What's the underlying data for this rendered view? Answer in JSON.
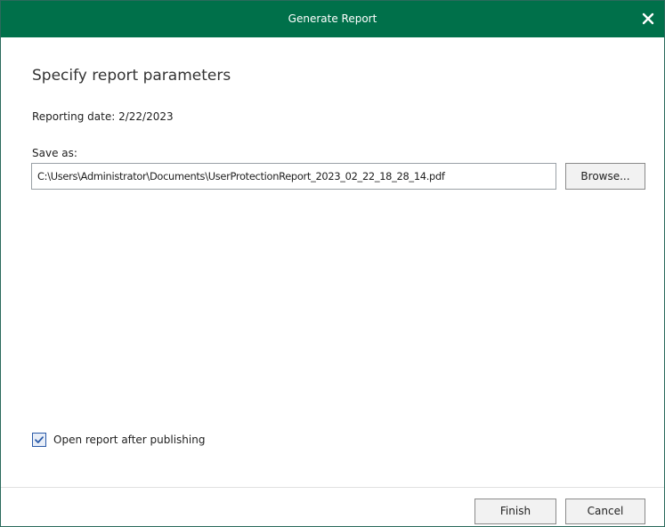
{
  "window": {
    "title": "Generate Report",
    "close_icon": "close-icon"
  },
  "main": {
    "heading": "Specify report parameters",
    "reporting_date_label": "Reporting date:",
    "reporting_date_value": "2/22/2023",
    "save_as_label": "Save as:",
    "save_as_value": "C:\\Users\\Administrator\\Documents\\UserProtectionReport_2023_02_22_18_28_14.pdf",
    "browse_label": "Browse...",
    "open_after_label": "Open report after publishing",
    "open_after_checked": true
  },
  "footer": {
    "finish_label": "Finish",
    "cancel_label": "Cancel"
  },
  "colors": {
    "titlebar": "#00704a",
    "checkbox_accent": "#2a5aa8"
  }
}
